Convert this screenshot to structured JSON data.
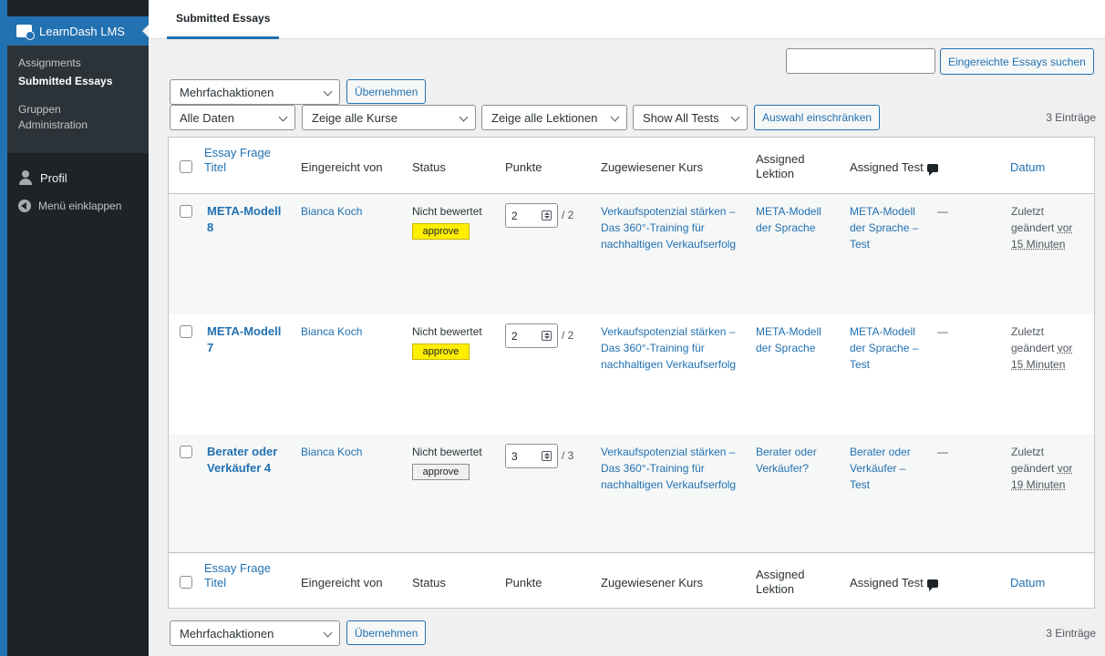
{
  "sidebar": {
    "menu_top": "LearnDash LMS",
    "submenu": [
      {
        "label": "Assignments"
      },
      {
        "label": "Submitted Essays"
      },
      {
        "label": "Gruppen Administration"
      }
    ],
    "profile": "Profil",
    "collapse": "Menü einklappen"
  },
  "tabs": {
    "active": "Submitted Essays"
  },
  "search": {
    "value": "",
    "button": "Eingereichte Essays suchen"
  },
  "bulk": {
    "select": "Mehrfachaktionen",
    "apply": "Übernehmen"
  },
  "filters": {
    "dates": "Alle Daten",
    "courses": "Zeige alle Kurse",
    "lessons": "Zeige alle Lektionen",
    "tests": "Show All Tests",
    "filter_button": "Auswahl einschränken"
  },
  "count": "3 Einträge",
  "columns": {
    "title": "Essay Frage Titel",
    "submitted_by": "Eingereicht von",
    "status": "Status",
    "points": "Punkte",
    "course": "Zugewiesener Kurs",
    "lesson": "Assigned Lektion",
    "test": "Assigned Test",
    "comments": "—",
    "date": "Datum"
  },
  "rows": [
    {
      "title": "META-Modell 8",
      "submitted_by": "Bianca Koch",
      "status": "Nicht bewertet",
      "approve": "approve",
      "points": "2",
      "max_points": "/ 2",
      "course": "Verkaufspotenzial stärken – Das 360°-Training für nachhaltigen Verkaufserfolg",
      "lesson": "META-Modell der Sprache",
      "test": "META-Modell der Sprache – Test",
      "comments": "—",
      "date_prefix": "Zuletzt geändert",
      "date_ago": "vor 15 Minuten"
    },
    {
      "title": "META-Modell 7",
      "submitted_by": "Bianca Koch",
      "status": "Nicht bewertet",
      "approve": "approve",
      "points": "2",
      "max_points": "/ 2",
      "course": "Verkaufspotenzial stärken – Das 360°-Training für nachhaltigen Verkaufserfolg",
      "lesson": "META-Modell der Sprache",
      "test": "META-Modell der Sprache – Test",
      "comments": "—",
      "date_prefix": "Zuletzt geändert",
      "date_ago": "vor 15 Minuten"
    },
    {
      "title": "Berater oder Verkäufer 4",
      "submitted_by": "Bianca Koch",
      "status": "Nicht bewertet",
      "approve": "approve",
      "points": "3",
      "max_points": "/ 3",
      "course": "Verkaufspotenzial stärken – Das 360°-Training für nachhaltigen Verkaufserfolg",
      "lesson": "Berater oder Verkäufer?",
      "test": "Berater oder Verkäufer – Test",
      "comments": "—",
      "date_prefix": "Zuletzt geändert",
      "date_ago": "vor 19 Minuten"
    }
  ]
}
